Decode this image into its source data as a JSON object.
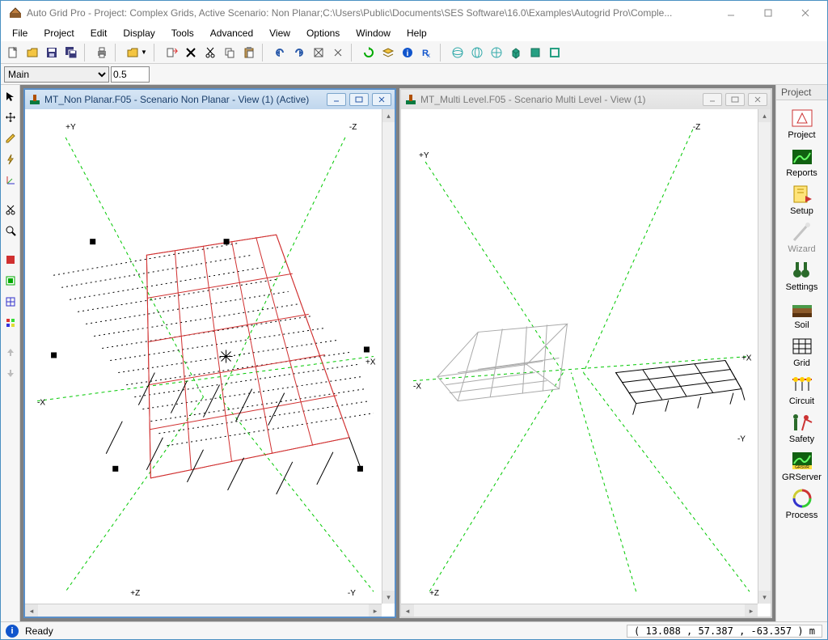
{
  "title": "Auto Grid Pro - Project: Complex Grids, Active Scenario: Non Planar;C:\\Users\\Public\\Documents\\SES Software\\16.0\\Examples\\Autogrid Pro\\Comple...",
  "menu": [
    "File",
    "Project",
    "Edit",
    "Display",
    "Tools",
    "Advanced",
    "View",
    "Options",
    "Window",
    "Help"
  ],
  "layer_selector": {
    "value": "Main",
    "options": [
      "Main"
    ]
  },
  "zoom_value": "0.5",
  "status": {
    "text": "Ready",
    "coords": "(   13.088 ,   57.387 ,  -63.357  ) m"
  },
  "windows": {
    "left": {
      "title": "MT_Non Planar.F05 - Scenario Non Planar - View (1)  (Active)",
      "active": true,
      "axes": {
        "py": "+Y",
        "mz": "-Z",
        "mx": "-X",
        "px": "+X",
        "pz": "+Z",
        "my": "-Y"
      }
    },
    "right": {
      "title": "MT_Multi Level.F05 - Scenario Multi Level - View (1)",
      "active": false,
      "axes": {
        "py": "+Y",
        "mz": "-Z",
        "mx": "-X",
        "px": "+X",
        "pz": "+Z",
        "my": "-Y"
      }
    }
  },
  "side_panel": {
    "tab": "Project",
    "items": [
      {
        "label": "Project",
        "disabled": false
      },
      {
        "label": "Reports",
        "disabled": false
      },
      {
        "label": "Setup",
        "disabled": false
      },
      {
        "label": "Wizard",
        "disabled": true
      },
      {
        "label": "Settings",
        "disabled": false
      },
      {
        "label": "Soil",
        "disabled": false
      },
      {
        "label": "Grid",
        "disabled": false
      },
      {
        "label": "Circuit",
        "disabled": false
      },
      {
        "label": "Safety",
        "disabled": false
      },
      {
        "label": "GRServer",
        "disabled": false
      },
      {
        "label": "Process",
        "disabled": false
      }
    ]
  },
  "main_toolbar_icons": [
    "new-doc-icon",
    "open-icon",
    "save-icon",
    "save-all-icon",
    "print-icon",
    "folder-dropdown-icon",
    "export-icon",
    "delete-icon",
    "cut-icon",
    "copy-icon",
    "paste-icon",
    "undo-icon",
    "redo-icon",
    "transform-icon",
    "merge-icon",
    "refresh-icon",
    "layers-icon",
    "info-icon",
    "rx-icon",
    "globe-a-icon",
    "globe-b-icon",
    "globe-c-icon",
    "box-a-icon",
    "box-b-icon",
    "box-c-icon"
  ],
  "left_toolbar_icons": [
    "pointer-icon",
    "move-icon",
    "pencil-icon",
    "bolt-icon",
    "axis-icon",
    "scissors-icon",
    "zoom-icon",
    "red-doc-icon",
    "green-doc-icon",
    "grid-sel-icon",
    "palette-icon",
    "arrow-up-icon",
    "arrow-down-icon"
  ]
}
